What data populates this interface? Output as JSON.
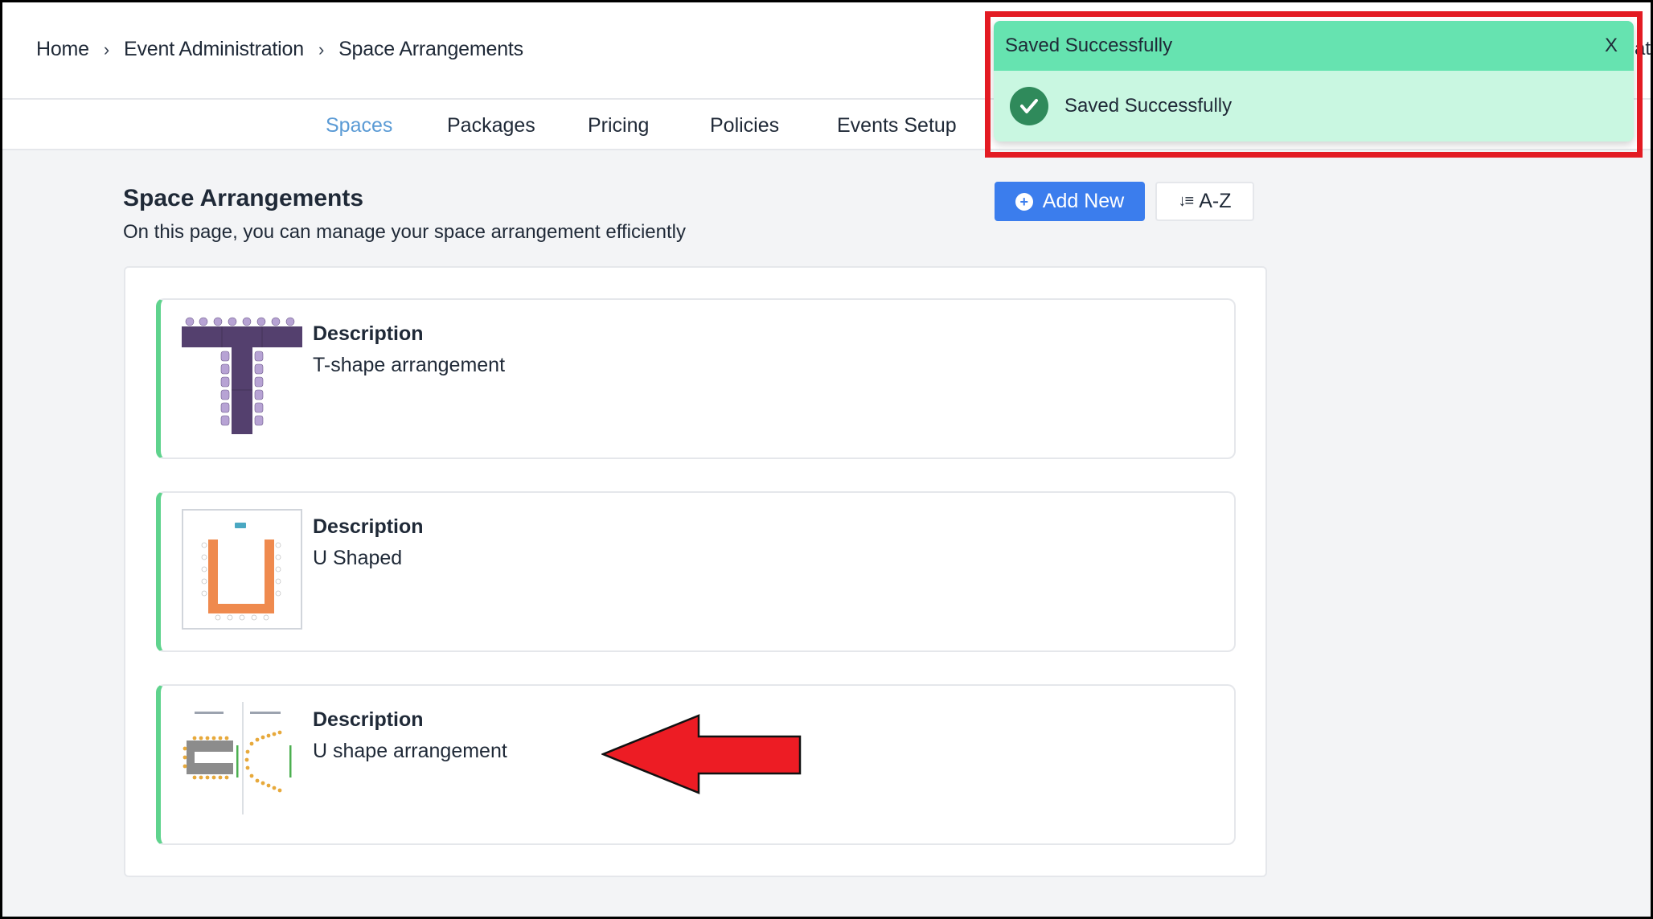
{
  "breadcrumb": {
    "items": [
      "Home",
      "Event Administration",
      "Space Arrangements"
    ],
    "separator": "›"
  },
  "tabs": [
    {
      "label": "Spaces",
      "active": true
    },
    {
      "label": "Packages",
      "active": false
    },
    {
      "label": "Pricing",
      "active": false
    },
    {
      "label": "Policies",
      "active": false
    },
    {
      "label": "Events Setup",
      "active": false
    }
  ],
  "page": {
    "title": "Space Arrangements",
    "subtitle": "On this page, you can manage your space arrangement efficiently"
  },
  "toolbar": {
    "add_new_label": "Add New",
    "add_icon": "plus-circle-icon",
    "sort_label": "A-Z",
    "sort_icon": "sort-descending-icon"
  },
  "arrangements": [
    {
      "label": "Description",
      "value": "T-shape arrangement",
      "thumbnail": "t-shape-layout",
      "thumb_color": "#54406e"
    },
    {
      "label": "Description",
      "value": "U Shaped",
      "thumbnail": "u-shape-layout",
      "thumb_color": "#ef8a4e"
    },
    {
      "label": "Description",
      "value": "U shape arrangement",
      "thumbnail": "u-shape-seating-diagram",
      "thumb_color": "#e7a93b"
    }
  ],
  "toast": {
    "title": "Saved Successfully",
    "message": "Saved Successfully",
    "close_label": "X",
    "header_color": "#66e3b0",
    "body_color": "#c9f7e1"
  },
  "background_partial_text": "at",
  "colors": {
    "accent": "#3b7ded",
    "active_tab": "#5b9bd5",
    "card_accent": "#5fd38d",
    "annotation": "#e31b23"
  }
}
